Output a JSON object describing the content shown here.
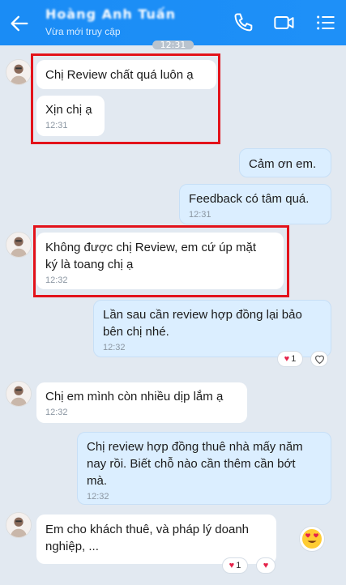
{
  "header": {
    "contact_name": "Hoàng Anh Tuấn",
    "status": "Vừa mới truy cập"
  },
  "top_timestamp": "12:31",
  "messages": [
    {
      "text": "Chị Review chất quá luôn ạ",
      "time": ""
    },
    {
      "text": "Xịn chị ạ",
      "time": "12:31"
    },
    {
      "text": "Cảm ơn em.",
      "time": ""
    },
    {
      "text": "Feedback có tâm quá.",
      "time": "12:31"
    },
    {
      "line1": "Không được chị Review, em cứ úp mặt",
      "line2": "ký là toang chị ạ",
      "time": "12:32"
    },
    {
      "line1": "Lần sau cần review hợp đồng lại bảo",
      "line2": "bên chị nhé.",
      "time": "12:32"
    },
    {
      "text": "Chị em mình còn nhiều dịp lắm ạ",
      "time": "12:32"
    },
    {
      "line1": "Chị review hợp đồng thuê nhà mấy năm",
      "line2": "nay rồi. Biết chỗ nào cần thêm cần bớt",
      "line3": "mà.",
      "time": "12:32"
    },
    {
      "line1": "Em cho khách thuê, và pháp lý doanh",
      "line2": "nghiệp, ..."
    }
  ],
  "reactions": {
    "msg6_count": "1",
    "msg9_count": "1"
  },
  "colors": {
    "header": "#1e90f8",
    "outgoing_bubble": "#dbeeff",
    "incoming_bubble": "#ffffff",
    "highlight_box": "#e3131b",
    "background": "#e2e9f1"
  }
}
